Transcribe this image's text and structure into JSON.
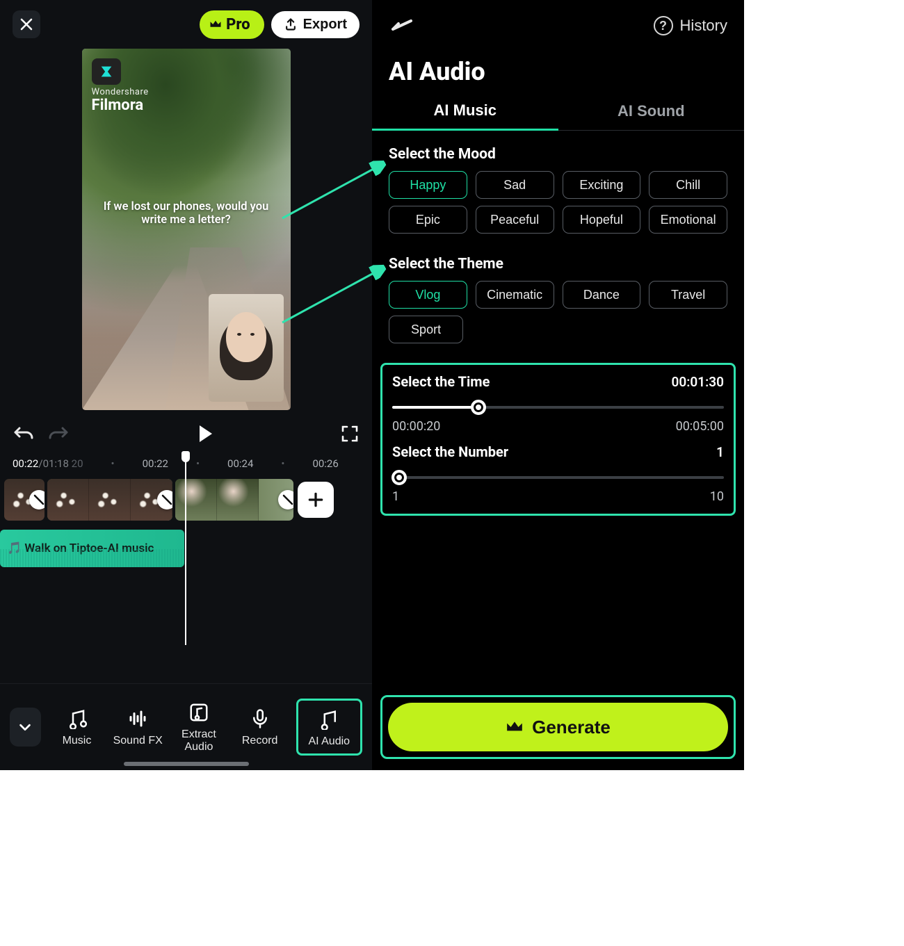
{
  "left": {
    "pro_label": "Pro",
    "export_label": "Export",
    "watermark_sub": "Wondershare",
    "watermark_brand": "Filmora",
    "subtitle_text": "If we lost our phones, would you write me a letter?",
    "time_current": "00:22",
    "time_total": "01:18",
    "ruler": [
      "20",
      "00:22",
      "00:24",
      "00:26"
    ],
    "audio_track_label": "🎵 Walk on Tiptoe-AI music",
    "tools": {
      "music": "Music",
      "soundfx": "Sound FX",
      "extract": "Extract Audio",
      "record": "Record",
      "aiaudio": "AI Audio"
    }
  },
  "right": {
    "history_label": "History",
    "title": "AI Audio",
    "tabs": {
      "music": "AI Music",
      "sound": "AI Sound",
      "active": "music"
    },
    "mood": {
      "label": "Select the Mood",
      "options": [
        "Happy",
        "Sad",
        "Exciting",
        "Chill",
        "Epic",
        "Peaceful",
        "Hopeful",
        "Emotional"
      ],
      "selected": "Happy"
    },
    "theme": {
      "label": "Select the Theme",
      "options": [
        "Vlog",
        "Cinematic",
        "Dance",
        "Travel",
        "Sport"
      ],
      "selected": "Vlog"
    },
    "time": {
      "label": "Select the Time",
      "value": "00:01:30",
      "min": "00:00:20",
      "max": "00:05:00",
      "fill_pct": 26
    },
    "number": {
      "label": "Select the Number",
      "value": "1",
      "min": "1",
      "max": "10",
      "fill_pct": 0
    },
    "generate_label": "Generate"
  }
}
